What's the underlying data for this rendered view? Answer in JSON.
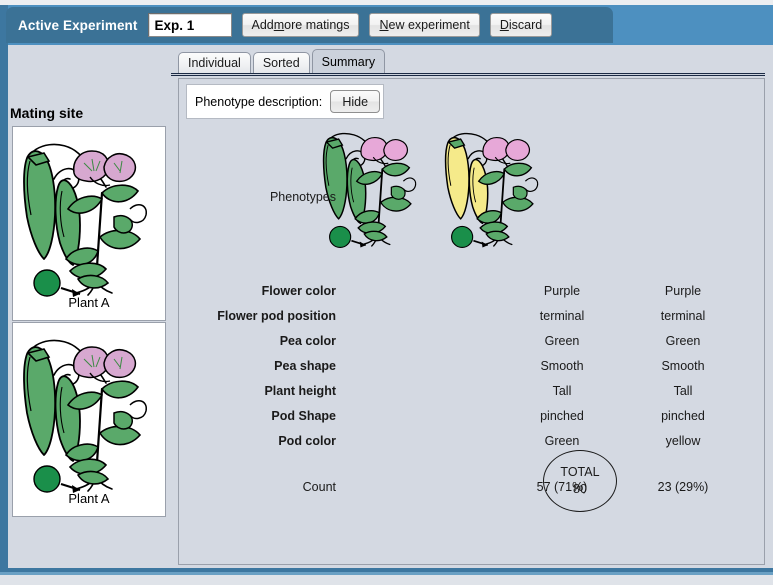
{
  "header": {
    "active_experiment_label": "Active Experiment",
    "experiment_name": "Exp. 1",
    "experiment_placeholder": "Exp. 1",
    "buttons": [
      {
        "label_pre": "Add ",
        "mnemonic": "m",
        "label_post": "ore matings",
        "name": "add-more-matings-button"
      },
      {
        "label_pre": "",
        "mnemonic": "N",
        "label_post": "ew experiment",
        "name": "new-experiment-button"
      },
      {
        "label_pre": "",
        "mnemonic": "D",
        "label_post": "iscard",
        "name": "discard-button"
      }
    ]
  },
  "sidebar": {
    "title": "Mating site",
    "plants": [
      {
        "caption": "Plant A",
        "pod_color": "#5aa96a",
        "flower_color": "#d7a8d0"
      },
      {
        "caption": "Plant A",
        "pod_color": "#5aa96a",
        "flower_color": "#d7a8d0"
      }
    ]
  },
  "tabs": [
    {
      "label": "Individual",
      "active": false
    },
    {
      "label": "Sorted",
      "active": false
    },
    {
      "label": "Summary",
      "active": true
    }
  ],
  "phenotype_description": {
    "label": "Phenotype description:",
    "toggle_label": "Hide"
  },
  "table": {
    "phenotypes_label": "Phenotypes",
    "count_label": "Count",
    "rows": [
      {
        "label": "Flower color",
        "values": [
          "Purple",
          "Purple"
        ]
      },
      {
        "label": "Flower pod position",
        "values": [
          "terminal",
          "terminal"
        ]
      },
      {
        "label": "Pea color",
        "values": [
          "Green",
          "Green"
        ]
      },
      {
        "label": "Pea shape",
        "values": [
          "Smooth",
          "Smooth"
        ]
      },
      {
        "label": "Plant height",
        "values": [
          "Tall",
          "Tall"
        ]
      },
      {
        "label": "Pod Shape",
        "values": [
          "pinched",
          "pinched"
        ]
      },
      {
        "label": "Pod color",
        "values": [
          "Green",
          "yellow"
        ]
      }
    ],
    "counts": [
      "57 (71%)",
      "23 (29%)"
    ]
  },
  "total": {
    "label": "TOTAL",
    "value": "80"
  },
  "phenotype_plants": [
    {
      "pod_color": "#5aa96a",
      "flower_color": "#e7a8d8",
      "seed_color": "#1a8f4a"
    },
    {
      "pod_color": "#f5ea8a",
      "flower_color": "#e7a8d8",
      "seed_color": "#1a8f4a"
    }
  ],
  "colors": {
    "header_band": "#4d90c0",
    "toolbar_panel": "#3b7296",
    "app_background": "#d4d9e2",
    "panel_border": "#9aa0ab",
    "active_tab": "#ccd2dc"
  }
}
